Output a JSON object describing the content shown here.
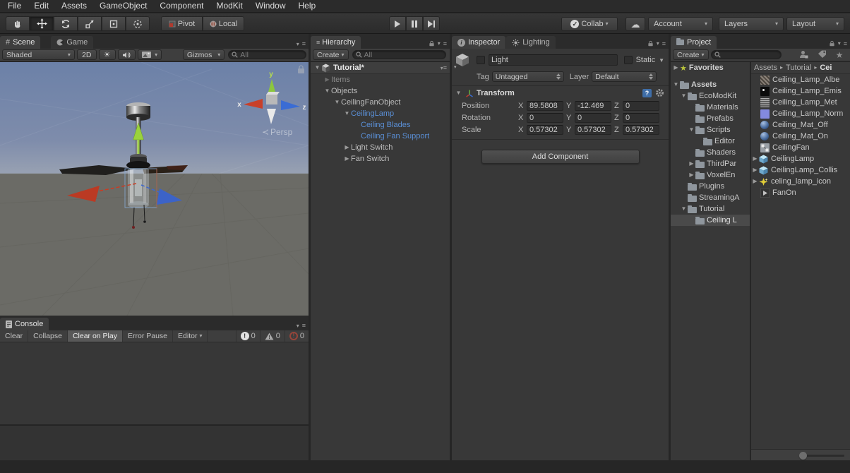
{
  "colors": {
    "accent_blue": "#5a8fd6",
    "sky_top": "#6c81a8",
    "ground": "#6b6b66",
    "selection_grey": "#4a4a4a",
    "favorite_star": "#b9c43c"
  },
  "menu_bar": {
    "items": [
      "File",
      "Edit",
      "Assets",
      "GameObject",
      "Component",
      "ModKit",
      "Window",
      "Help"
    ]
  },
  "toolbar": {
    "pivot": "Pivot",
    "local": "Local",
    "collab": "Collab",
    "account": "Account",
    "layers": "Layers",
    "layout": "Layout"
  },
  "scene_panel": {
    "tab_scene": "Scene",
    "tab_game": "Game",
    "shading_mode": "Shaded",
    "mode_2d": "2D",
    "gizmos": "Gizmos",
    "search_scope": "All",
    "projection_label": "Persp",
    "axis_x": "x",
    "axis_y": "y",
    "axis_z": "z"
  },
  "hierarchy_panel": {
    "title": "Hierarchy",
    "create": "Create",
    "search_scope": "All",
    "scene_name": "Tutorial*",
    "items": [
      {
        "label": "Items"
      },
      {
        "label": "Objects"
      },
      {
        "label": "CeilingFanObject"
      },
      {
        "label": "CeilingLamp"
      },
      {
        "label": "Ceiling Blades"
      },
      {
        "label": "Ceiling Fan Support"
      },
      {
        "label": "Light Switch"
      },
      {
        "label": "Fan Switch"
      }
    ]
  },
  "inspector_panel": {
    "tab_inspector": "Inspector",
    "tab_lighting": "Lighting",
    "name": "Light",
    "static_label": "Static",
    "tag_label": "Tag",
    "tag": "Untagged",
    "layer_label": "Layer",
    "layer": "Default",
    "transform": {
      "title": "Transform",
      "x": "X",
      "y": "Y",
      "z": "Z",
      "position": {
        "label": "Position",
        "x": "89.5808",
        "y": "-12.469",
        "z": "0"
      },
      "rotation": {
        "label": "Rotation",
        "x": "0",
        "y": "0",
        "z": "0"
      },
      "scale": {
        "label": "Scale",
        "x": "0.57302",
        "y": "0.57302",
        "z": "0.57302"
      }
    },
    "add_component": "Add Component"
  },
  "project_panel": {
    "title": "Project",
    "create": "Create",
    "tree": [
      {
        "label": "Favorites"
      },
      {
        "label": "Assets"
      },
      {
        "label": "EcoModKit"
      },
      {
        "label": "Materials"
      },
      {
        "label": "Prefabs"
      },
      {
        "label": "Scripts"
      },
      {
        "label": "Editor"
      },
      {
        "label": "Shaders"
      },
      {
        "label": "ThirdPar"
      },
      {
        "label": "VoxelEn"
      },
      {
        "label": "Plugins"
      },
      {
        "label": "StreamingA"
      },
      {
        "label": "Tutorial"
      },
      {
        "label": "Ceiling L"
      }
    ],
    "breadcrumb": {
      "root": "Assets",
      "mid": "Tutorial",
      "leaf": "Cei"
    },
    "assets": [
      {
        "label": "Ceiling_Lamp_Albe"
      },
      {
        "label": "Ceiling_Lamp_Emis"
      },
      {
        "label": "Ceiling_Lamp_Met"
      },
      {
        "label": "Ceiling_Lamp_Norm"
      },
      {
        "label": "Ceiling_Mat_Off"
      },
      {
        "label": "Ceiling_Mat_On"
      },
      {
        "label": "CeilingFan"
      },
      {
        "label": "CeilingLamp"
      },
      {
        "label": "CeilingLamp_Collis"
      },
      {
        "label": "celing_lamp_icon"
      },
      {
        "label": "FanOn"
      }
    ]
  },
  "console_panel": {
    "title": "Console",
    "clear": "Clear",
    "collapse": "Collapse",
    "clear_on_play": "Clear on Play",
    "error_pause": "Error Pause",
    "editor": "Editor",
    "info_count": "0",
    "warning_count": "0",
    "error_count": "0"
  }
}
